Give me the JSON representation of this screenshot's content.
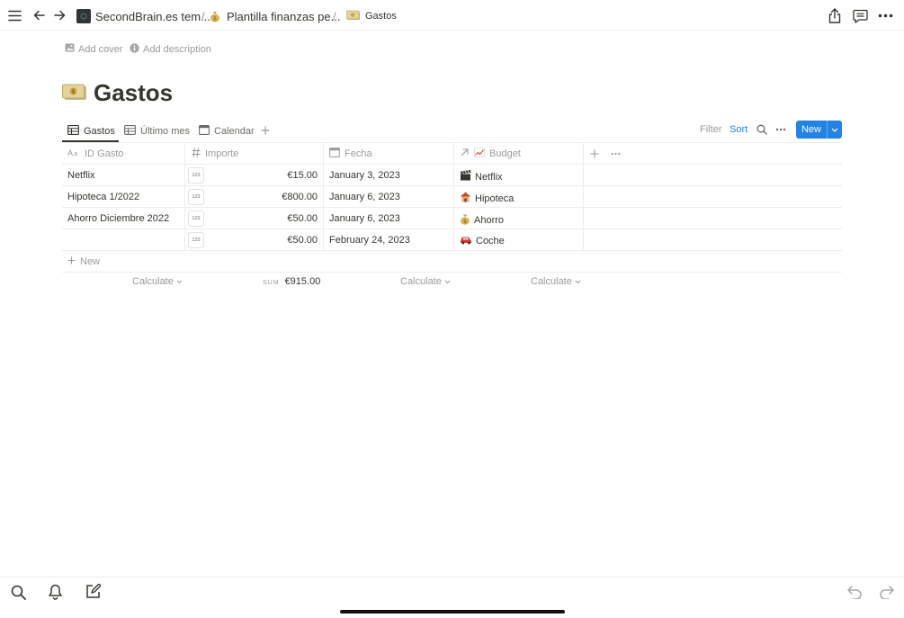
{
  "breadcrumb": [
    {
      "label": "SecondBrain.es tem..."
    },
    {
      "label": "Plantilla finanzas pe..."
    },
    {
      "label": "Gastos"
    }
  ],
  "breadcrumb_separator": "/",
  "page_header": {
    "add_cover": "Add cover",
    "add_description": "Add description",
    "title": "Gastos"
  },
  "views": {
    "tabs": [
      {
        "label": "Gastos",
        "icon": "table-icon",
        "active": true
      },
      {
        "label": "Último mes",
        "icon": "table-icon",
        "active": false
      },
      {
        "label": "Calendar",
        "icon": "calendar-icon",
        "active": false
      }
    ],
    "filter": "Filter",
    "sort": "Sort",
    "new": "New"
  },
  "table": {
    "columns": [
      {
        "label": "ID Gasto",
        "icon": "text-property-icon"
      },
      {
        "label": "Importe",
        "icon": "number-property-icon"
      },
      {
        "label": "Fecha",
        "icon": "date-property-icon"
      },
      {
        "label": "Budget",
        "icon": "relation-property-icon",
        "emoji": "chart-increasing-emoji"
      }
    ],
    "number_chip": "123",
    "rows": [
      {
        "id": "Netflix",
        "importe": "€15.00",
        "fecha": "January 3, 2023",
        "budget": "Netflix",
        "budget_icon": "clapper-board-emoji"
      },
      {
        "id": "Hipoteca 1/2022",
        "importe": "€800.00",
        "fecha": "January 6, 2023",
        "budget": "Hipoteca",
        "budget_icon": "house-emoji"
      },
      {
        "id": "Ahorro Diciembre 2022",
        "importe": "€50.00",
        "fecha": "January 6, 2023",
        "budget": "Ahorro",
        "budget_icon": "money-bag-emoji"
      },
      {
        "id": "",
        "importe": "€50.00",
        "fecha": "February 24, 2023",
        "budget": "Coche",
        "budget_icon": "car-emoji"
      }
    ],
    "new_row": "New",
    "footer": {
      "calculate": "Calculate",
      "sum_label": "SUM",
      "sum_value": "€915.00"
    }
  },
  "colors": {
    "accent": "#2383e2",
    "text": "#37352f",
    "muted": "#9b9a97",
    "border": "#ededeb"
  }
}
